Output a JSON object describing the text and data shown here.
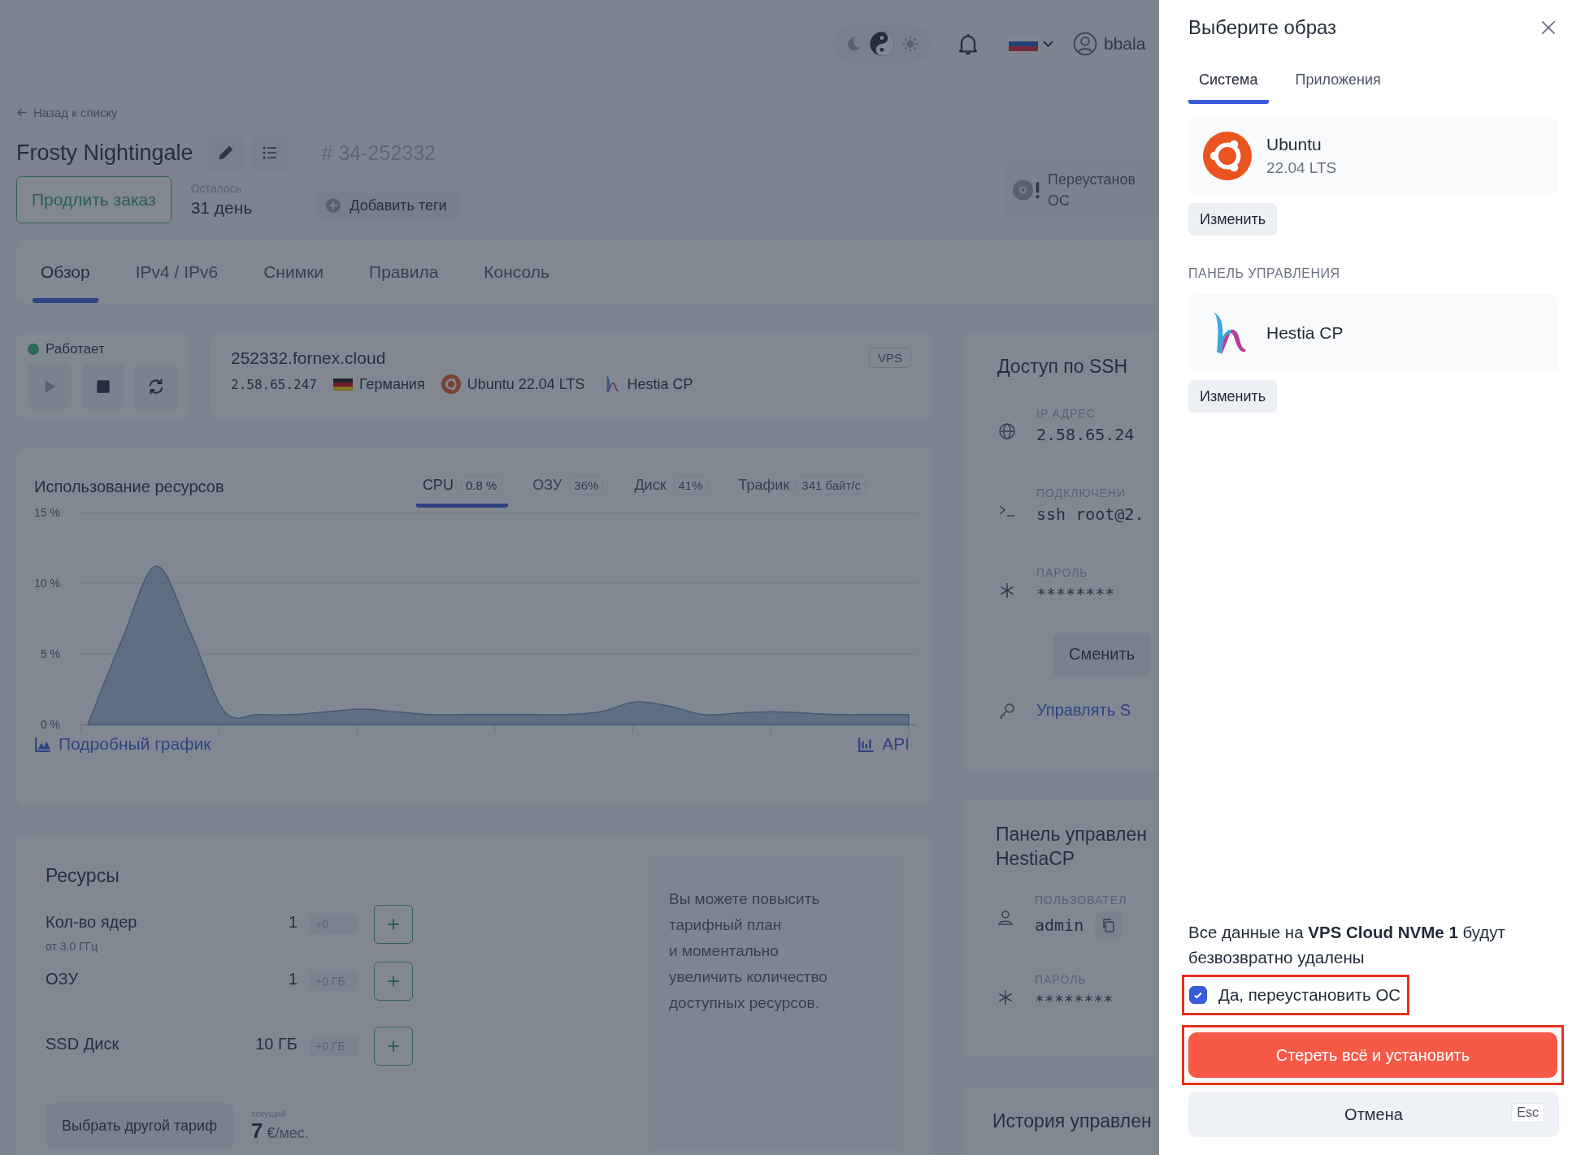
{
  "topbar": {
    "theme_modes": [
      {
        "kind": "dark",
        "selected": false
      },
      {
        "kind": "auto",
        "selected": true
      },
      {
        "kind": "light",
        "selected": false
      }
    ],
    "user": "bbala"
  },
  "back_link": "Назад к списку",
  "title": "Frosty Nightingale",
  "order_number": "# 34-252332",
  "renew_button": "Продлить заказ",
  "remaining": {
    "label": "Осталось",
    "value": "31 день"
  },
  "add_tags_button": "Добавить теги",
  "reinstall_card": {
    "lines": [
      "Переустанов",
      "ОС"
    ]
  },
  "tabs": [
    {
      "label": "Обзор",
      "selected": true
    },
    {
      "label": "IPv4 / IPv6",
      "selected": false
    },
    {
      "label": "Снимки",
      "selected": false
    },
    {
      "label": "Правила",
      "selected": false
    },
    {
      "label": "Консоль",
      "selected": false
    }
  ],
  "status": {
    "label": "Работает",
    "running": true
  },
  "server": {
    "hostname": "252332.fornex.cloud",
    "badge": "VPS",
    "ip": "2.58.65.247",
    "country": "Германия",
    "os": "Ubuntu 22.04 LTS",
    "panel": "Hestia CP"
  },
  "usage": {
    "title": "Использование ресурсов",
    "metrics": [
      {
        "label": "CPU",
        "value": "0.8 %",
        "selected": true
      },
      {
        "label": "ОЗУ",
        "value": "36%",
        "selected": false
      },
      {
        "label": "Диск",
        "value": "41%",
        "selected": false
      },
      {
        "label": "Трафик",
        "value": "341 байт/с",
        "selected": false
      }
    ],
    "chart_data": {
      "type": "area",
      "ylim": [
        0,
        15
      ],
      "yticks": [
        {
          "value": 0,
          "label": "0 %"
        },
        {
          "value": 5,
          "label": "5 %"
        },
        {
          "value": 10,
          "label": "10 %"
        },
        {
          "value": 15,
          "label": "15 %"
        }
      ],
      "series": [
        {
          "color": "#6f8fb5",
          "values": [
            0,
            6,
            11.2,
            6.5,
            0.9,
            0.7,
            0.7,
            0.9,
            1.1,
            0.9,
            0.7,
            0.7,
            0.7,
            0.7,
            0.7,
            0.9,
            1.6,
            1.3,
            0.7,
            0.8,
            0.9,
            0.8,
            0.7,
            0.7,
            0.7
          ]
        }
      ]
    },
    "detail_link": "Подробный график",
    "api_link": "API"
  },
  "resources": {
    "title": "Ресурсы",
    "rows": [
      {
        "label": "Кол-во ядер",
        "note": "от 3.0 ГГц",
        "value": "1",
        "delta": "+0"
      },
      {
        "label": "ОЗУ",
        "value": "1",
        "delta": "+0 ГБ"
      },
      {
        "label": "SSD Диск",
        "value": "10 ГБ",
        "delta": "+0 ГБ"
      }
    ],
    "upgrade_note": [
      "Вы можете повысить",
      "тарифный план",
      "и моментально",
      "увеличить количество",
      "доступных ресурсов."
    ],
    "change_plan_button": "Выбрать другой тариф",
    "price": {
      "label": "текущий",
      "amount": "7",
      "currency": "€",
      "period": "/мес."
    }
  },
  "ssh": {
    "title": "Доступ по SSH",
    "fields": [
      {
        "kind": "ip",
        "label": "IP АДРЕС",
        "value": "2.58.65.24"
      },
      {
        "kind": "terminal",
        "label": "ПОДКЛЮЧЕНИ",
        "value": "ssh root@2."
      },
      {
        "kind": "password",
        "label": "ПАРОЛЬ",
        "value": "********"
      }
    ],
    "change_button": "Сменить",
    "manage_link": "Управлять S"
  },
  "panel_card": {
    "title_lines": [
      "Панель управлен",
      "HestiaCP"
    ],
    "fields": [
      {
        "kind": "user",
        "label": "ПОЛЬЗОВАТЕЛ",
        "value": "admin",
        "copyable": true
      },
      {
        "kind": "password",
        "label": "ПАРОЛЬ",
        "value": "********",
        "copyable": false
      }
    ]
  },
  "history_card": {
    "title": "История управлен"
  },
  "drawer": {
    "title": "Выберите образ",
    "tabs": [
      {
        "label": "Система",
        "selected": true
      },
      {
        "label": "Приложения",
        "selected": false
      }
    ],
    "os": {
      "kind": "ubuntu",
      "name": "Ubuntu",
      "version": "22.04 LTS",
      "change_button": "Изменить"
    },
    "panel_heading": "ПАНЕЛЬ УПРАВЛЕНИЯ",
    "panel": {
      "kind": "hestia",
      "name": "Hestia CP",
      "change_button": "Изменить"
    },
    "warning": "Все данные на **VPS Cloud NVMe 1** будут безвозвратно удалены",
    "confirm": {
      "label": "Да, переустановить ОС",
      "checked": true
    },
    "erase_button": "Стереть всё и установить",
    "cancel_button": "Отмена",
    "cancel_key": "Esc"
  }
}
